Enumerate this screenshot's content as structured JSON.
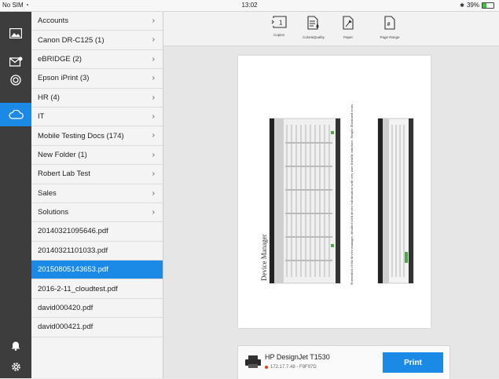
{
  "status": {
    "carrier": "No SIM",
    "time": "13:02",
    "battery": "39%"
  },
  "rail": {
    "items": [
      {
        "icon": "photos-icon"
      },
      {
        "icon": "email-icon"
      },
      {
        "icon": "browser-icon"
      },
      {
        "icon": "cloud-icon",
        "active": true
      }
    ],
    "bottom": [
      {
        "icon": "notification-bell-icon"
      },
      {
        "icon": "settings-gear-icon"
      }
    ]
  },
  "files": [
    {
      "label": "Accounts",
      "folder": true
    },
    {
      "label": "Canon DR-C125 (1)",
      "folder": true
    },
    {
      "label": "eBRIDGE (2)",
      "folder": true
    },
    {
      "label": "Epson iPrint (3)",
      "folder": true
    },
    {
      "label": "HR (4)",
      "folder": true
    },
    {
      "label": "IT",
      "folder": true
    },
    {
      "label": "Mobile Testing Docs (174)",
      "folder": true
    },
    {
      "label": "New Folder (1)",
      "folder": true
    },
    {
      "label": "Robert Lab Test",
      "folder": true
    },
    {
      "label": "Sales",
      "folder": true
    },
    {
      "label": "Solutions",
      "folder": true
    },
    {
      "label": "20140321095646.pdf"
    },
    {
      "label": "20140321101033.pdf"
    },
    {
      "label": "20150805143653.pdf",
      "selected": true
    },
    {
      "label": "2016-2-11_cloudtest.pdf"
    },
    {
      "label": "david000420.pdf"
    },
    {
      "label": "david000421.pdf"
    }
  ],
  "toolbar": {
    "copies": {
      "value": "1",
      "label": "Copies"
    },
    "color": {
      "label": "Color&Quality"
    },
    "paper": {
      "label": "Paper"
    },
    "range": {
      "label": "Page Range"
    }
  },
  "document": {
    "title": "Device Manager",
    "caption": "Screenshot of the device manager, detailed with device information with very user friendly interface. Simple illustrated icons"
  },
  "printer": {
    "name": "HP DesignJet T1530",
    "address": "172.17.7.48 - F9F97D",
    "print_label": "Print"
  }
}
